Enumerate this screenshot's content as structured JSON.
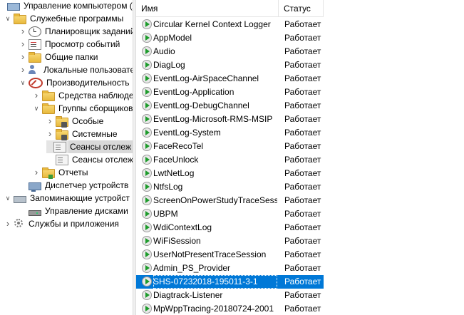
{
  "tree": {
    "items": [
      {
        "label": "Управление компьютером (л",
        "icon": "computer-icon",
        "level": 0,
        "chevron": ""
      },
      {
        "label": "Служебные программы",
        "icon": "folder-icon",
        "level": 1,
        "chevron": "expanded"
      },
      {
        "label": "Планировщик заданий",
        "icon": "clock-icon",
        "level": 2,
        "chevron": "collapsed"
      },
      {
        "label": "Просмотр событий",
        "icon": "event-viewer-icon",
        "level": 2,
        "chevron": "collapsed"
      },
      {
        "label": "Общие папки",
        "icon": "shared-folder-icon",
        "level": 2,
        "chevron": "collapsed"
      },
      {
        "label": "Локальные пользовате",
        "icon": "users-icon",
        "level": 2,
        "chevron": "collapsed"
      },
      {
        "label": "Производительность",
        "icon": "performance-icon",
        "level": 2,
        "chevron": "expanded"
      },
      {
        "label": "Средства наблюде",
        "icon": "monitoring-folder-icon",
        "level": 3,
        "chevron": "collapsed"
      },
      {
        "label": "Группы сборщиков",
        "icon": "folder-icon",
        "level": 3,
        "chevron": "expanded"
      },
      {
        "label": "Особые",
        "icon": "collector-folder-icon",
        "level": 4,
        "chevron": "collapsed"
      },
      {
        "label": "Системные",
        "icon": "collector-folder-icon",
        "level": 4,
        "chevron": "collapsed"
      },
      {
        "label": "Сеансы отслеж",
        "icon": "session-icon",
        "level": 4,
        "chevron": "",
        "selected": true
      },
      {
        "label": "Сеансы отслеж",
        "icon": "session-icon",
        "level": 4,
        "chevron": ""
      },
      {
        "label": "Отчеты",
        "icon": "reports-folder-icon",
        "level": 3,
        "chevron": "collapsed"
      },
      {
        "label": "Диспетчер устройств",
        "icon": "device-manager-icon",
        "level": 2,
        "chevron": ""
      },
      {
        "label": "Запоминающие устройст",
        "icon": "storage-icon",
        "level": 1,
        "chevron": "expanded"
      },
      {
        "label": "Управление дисками",
        "icon": "disk-icon",
        "level": 2,
        "chevron": ""
      },
      {
        "label": "Службы и приложения",
        "icon": "services-icon",
        "level": 1,
        "chevron": "collapsed"
      }
    ]
  },
  "list": {
    "columns": {
      "name": "Имя",
      "status": "Статус"
    },
    "rows": [
      {
        "name": "Circular Kernel Context Logger",
        "status": "Работает"
      },
      {
        "name": "AppModel",
        "status": "Работает"
      },
      {
        "name": "Audio",
        "status": "Работает"
      },
      {
        "name": "DiagLog",
        "status": "Работает"
      },
      {
        "name": "EventLog-AirSpaceChannel",
        "status": "Работает"
      },
      {
        "name": "EventLog-Application",
        "status": "Работает"
      },
      {
        "name": "EventLog-DebugChannel",
        "status": "Работает"
      },
      {
        "name": "EventLog-Microsoft-RMS-MSIP",
        "status": "Работает"
      },
      {
        "name": "EventLog-System",
        "status": "Работает"
      },
      {
        "name": "FaceRecoTel",
        "status": "Работает"
      },
      {
        "name": "FaceUnlock",
        "status": "Работает"
      },
      {
        "name": "LwtNetLog",
        "status": "Работает"
      },
      {
        "name": "NtfsLog",
        "status": "Работает"
      },
      {
        "name": "ScreenOnPowerStudyTraceSessi",
        "status": "Работает"
      },
      {
        "name": "UBPM",
        "status": "Работает"
      },
      {
        "name": "WdiContextLog",
        "status": "Работает"
      },
      {
        "name": "WiFiSession",
        "status": "Работает"
      },
      {
        "name": "UserNotPresentTraceSession",
        "status": "Работает"
      },
      {
        "name": "Admin_PS_Provider",
        "status": "Работает"
      },
      {
        "name": "SHS-07232018-195011-3-1",
        "status": "Работает",
        "selected": true
      },
      {
        "name": "Diagtrack-Listener",
        "status": "Работает"
      },
      {
        "name": "MpWppTracing-20180724-2001",
        "status": "Работает"
      }
    ]
  }
}
